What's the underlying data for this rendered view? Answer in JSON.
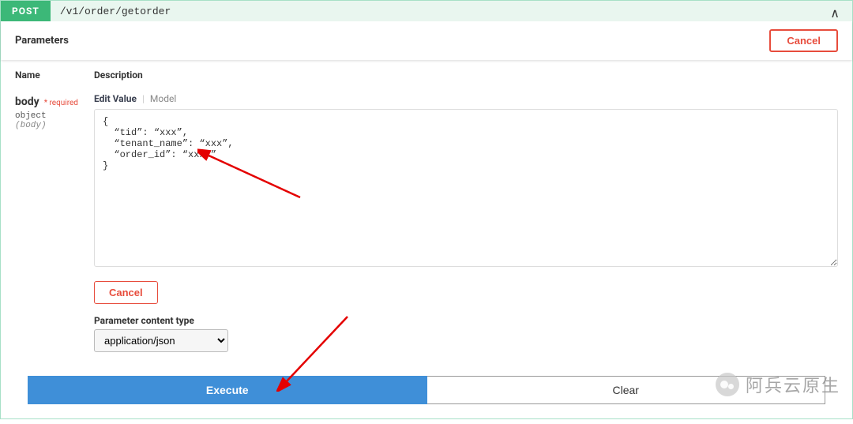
{
  "endpoint": {
    "method": "POST",
    "path": "/v1/order/getorder",
    "chevron": "∧"
  },
  "section": {
    "parameters_label": "Parameters",
    "cancel_label": "Cancel"
  },
  "columns": {
    "name": "Name",
    "description": "Description"
  },
  "param": {
    "name": "body",
    "required_label": "* required",
    "type": "object",
    "in": "(body)",
    "tab_edit": "Edit Value",
    "tab_model": "Model",
    "body_value": "{\n  “tid”: “xxx”,\n  “tenant_name”: “xxx”,\n  “order_id”: “xxxx”\n}",
    "cancel_label": "Cancel",
    "content_type_label": "Parameter content type",
    "content_type_value": "application/json"
  },
  "actions": {
    "execute": "Execute",
    "clear": "Clear"
  },
  "watermark": "阿兵云原生"
}
